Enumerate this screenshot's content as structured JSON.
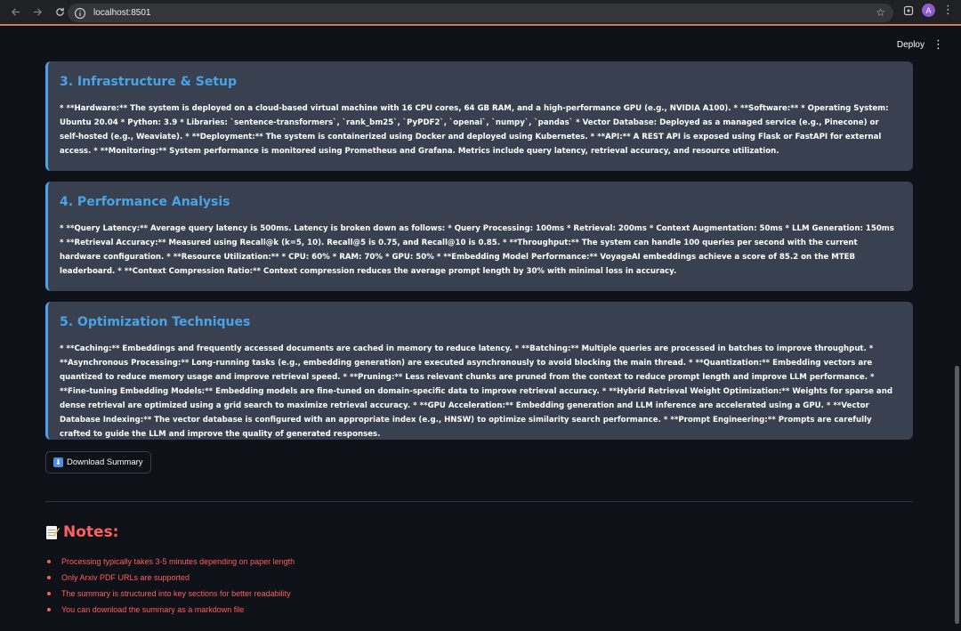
{
  "browser": {
    "url": "localhost:8501",
    "avatar_letter": "A"
  },
  "app": {
    "deploy_label": "Deploy"
  },
  "sections": [
    {
      "title": "3. Infrastructure & Setup",
      "body": "* **Hardware:** The system is deployed on a cloud-based virtual machine with 16 CPU cores, 64 GB RAM, and a high-performance GPU (e.g., NVIDIA A100). * **Software:** * Operating System: Ubuntu 20.04 * Python: 3.9 * Libraries: `sentence-transformers`, `rank_bm25`, `PyPDF2`, `openai`, `numpy`, `pandas` * Vector Database: Deployed as a managed service (e.g., Pinecone) or self-hosted (e.g., Weaviate). * **Deployment:** The system is containerized using Docker and deployed using Kubernetes. * **API:** A REST API is exposed using Flask or FastAPI for external access. * **Monitoring:** System performance is monitored using Prometheus and Grafana. Metrics include query latency, retrieval accuracy, and resource utilization."
    },
    {
      "title": "4. Performance Analysis",
      "body": "* **Query Latency:** Average query latency is 500ms. Latency is broken down as follows: * Query Processing: 100ms * Retrieval: 200ms * Context Augmentation: 50ms * LLM Generation: 150ms * **Retrieval Accuracy:** Measured using Recall@k (k=5, 10). Recall@5 is 0.75, and Recall@10 is 0.85. * **Throughput:** The system can handle 100 queries per second with the current hardware configuration. * **Resource Utilization:** * CPU: 60% * RAM: 70% * GPU: 50% * **Embedding Model Performance:** VoyageAI embeddings achieve a score of 85.2 on the MTEB leaderboard. * **Context Compression Ratio:** Context compression reduces the average prompt length by 30% with minimal loss in accuracy."
    },
    {
      "title": "5. Optimization Techniques",
      "body": "* **Caching:** Embeddings and frequently accessed documents are cached in memory to reduce latency. * **Batching:** Multiple queries are processed in batches to improve throughput. * **Asynchronous Processing:** Long-running tasks (e.g., embedding generation) are executed asynchronously to avoid blocking the main thread. * **Quantization:** Embedding vectors are quantized to reduce memory usage and improve retrieval speed. * **Pruning:** Less relevant chunks are pruned from the context to reduce prompt length and improve LLM performance. * **Fine-tuning Embedding Models:** Embedding models are fine-tuned on domain-specific data to improve retrieval accuracy. * **Hybrid Retrieval Weight Optimization:** Weights for sparse and dense retrieval are optimized using a grid search to maximize retrieval accuracy. * **GPU Acceleration:** Embedding generation and LLM inference are accelerated using a GPU. * **Vector Database Indexing:** The vector database is configured with an appropriate index (e.g., HNSW) to optimize similarity search performance. * **Prompt Engineering:** Prompts are carefully crafted to guide the LLM and improve the quality of generated responses."
    }
  ],
  "download_button": {
    "label": "Download Summary",
    "icon": "download-arrow-icon"
  },
  "notes": {
    "title": "Notes:",
    "icon": "memo-icon",
    "items": [
      "Processing typically takes 3-5 minutes depending on paper length",
      "Only Arxiv PDF URLs are supported",
      "The summary is structured into key sections for better readability",
      "You can download the summary as a markdown file"
    ]
  },
  "colors": {
    "background": "#0e1117",
    "card": "#394150",
    "accent_blue": "#4aa3e6",
    "notes_red": "#ff5f5f"
  }
}
